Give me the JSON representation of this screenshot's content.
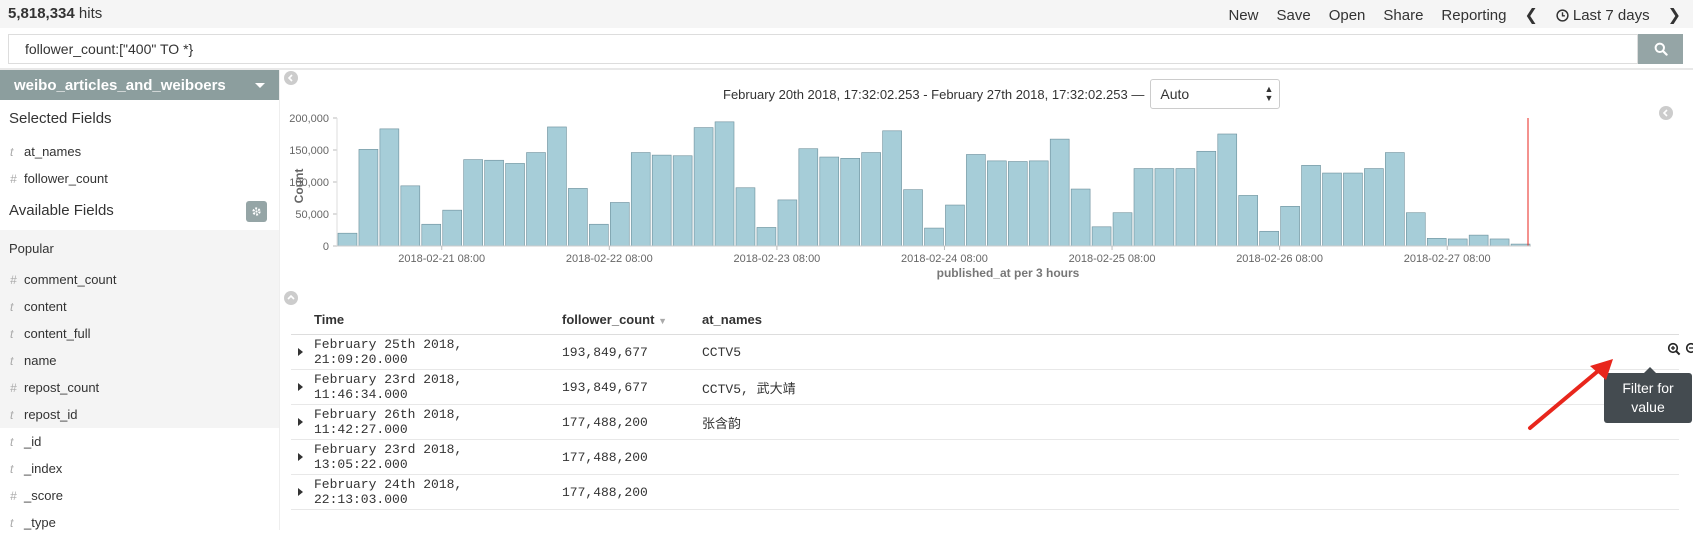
{
  "topbar": {
    "hits_count": "5,818,334",
    "hits_label": " hits",
    "menu": [
      "New",
      "Save",
      "Open",
      "Share",
      "Reporting"
    ],
    "time_range": "Last 7 days"
  },
  "query": {
    "value": "follower_count:[\"400\" TO *}"
  },
  "sidebar": {
    "index_pattern": "weibo_articles_and_weiboers",
    "selected_title": "Selected Fields",
    "selected_fields": [
      {
        "type": "t",
        "name": "at_names"
      },
      {
        "type": "#",
        "name": "follower_count"
      }
    ],
    "available_title": "Available Fields",
    "popular_title": "Popular",
    "popular_fields": [
      {
        "type": "#",
        "name": "comment_count"
      },
      {
        "type": "t",
        "name": "content"
      },
      {
        "type": "t",
        "name": "content_full"
      },
      {
        "type": "t",
        "name": "name"
      },
      {
        "type": "#",
        "name": "repost_count"
      },
      {
        "type": "t",
        "name": "repost_id"
      }
    ],
    "other_fields": [
      {
        "type": "t",
        "name": "_id"
      },
      {
        "type": "t",
        "name": "_index"
      },
      {
        "type": "#",
        "name": "_score"
      },
      {
        "type": "t",
        "name": "_type"
      }
    ]
  },
  "histogram": {
    "date_range": "February 20th 2018, 17:32:02.253 - February 27th 2018, 17:32:02.253 —",
    "interval": "Auto"
  },
  "chart_data": {
    "type": "bar",
    "ylabel": "Count",
    "xlabel": "published_at per 3 hours",
    "ylim": [
      0,
      200000
    ],
    "y_ticks": [
      "0",
      "50,000",
      "100,000",
      "150,000",
      "200,000"
    ],
    "x_ticks": [
      "2018-02-21 08:00",
      "2018-02-22 08:00",
      "2018-02-23 08:00",
      "2018-02-24 08:00",
      "2018-02-25 08:00",
      "2018-02-26 08:00",
      "2018-02-27 08:00"
    ],
    "values": [
      20000,
      151000,
      183000,
      94000,
      34000,
      56000,
      135000,
      134000,
      129000,
      146000,
      186000,
      90000,
      34000,
      68000,
      146000,
      142000,
      141000,
      185000,
      194000,
      91000,
      29000,
      72000,
      152000,
      139000,
      137000,
      146000,
      180000,
      88000,
      28000,
      64000,
      143000,
      133000,
      132000,
      133000,
      167000,
      89000,
      30000,
      52000,
      121000,
      121000,
      121000,
      148000,
      175000,
      79000,
      23000,
      62000,
      126000,
      114000,
      114000,
      121000,
      146000,
      52000,
      12000,
      11000,
      17000,
      11000,
      3000
    ]
  },
  "table": {
    "headers": [
      "Time",
      "follower_count",
      "at_names"
    ],
    "rows": [
      {
        "time": "February 25th 2018, 21:09:20.000",
        "follower_count": "193,849,677",
        "at_names": "CCTV5"
      },
      {
        "time": "February 23rd 2018, 11:46:34.000",
        "follower_count": "193,849,677",
        "at_names": "CCTV5, 武大靖"
      },
      {
        "time": "February 26th 2018, 11:42:27.000",
        "follower_count": "177,488,200",
        "at_names": "张含韵"
      },
      {
        "time": "February 23rd 2018, 13:05:22.000",
        "follower_count": "177,488,200",
        "at_names": ""
      },
      {
        "time": "February 24th 2018, 22:13:03.000",
        "follower_count": "177,488,200",
        "at_names": ""
      }
    ]
  },
  "tooltip": {
    "text": "Filter for value"
  },
  "colors": {
    "bar": "#a6cdd8",
    "bar_stroke": "#6b8e9a",
    "accent": "#95a5a6",
    "arrow": "#e8261c"
  }
}
